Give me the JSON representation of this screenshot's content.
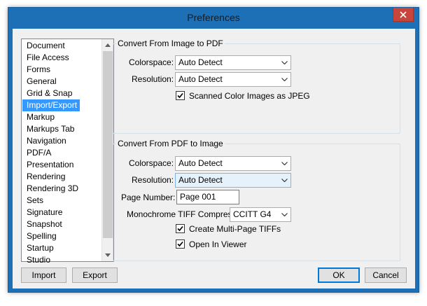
{
  "window": {
    "title": "Preferences"
  },
  "sidebar": {
    "items": [
      {
        "label": "Document"
      },
      {
        "label": "File Access"
      },
      {
        "label": "Forms"
      },
      {
        "label": "General"
      },
      {
        "label": "Grid & Snap"
      },
      {
        "label": "Import/Export",
        "selected": true
      },
      {
        "label": "Markup"
      },
      {
        "label": "Markups Tab"
      },
      {
        "label": "Navigation"
      },
      {
        "label": "PDF/A"
      },
      {
        "label": "Presentation"
      },
      {
        "label": "Rendering"
      },
      {
        "label": "Rendering 3D"
      },
      {
        "label": "Sets"
      },
      {
        "label": "Signature"
      },
      {
        "label": "Snapshot"
      },
      {
        "label": "Spelling"
      },
      {
        "label": "Startup"
      },
      {
        "label": "Studio"
      }
    ]
  },
  "image_to_pdf": {
    "title": "Convert From Image to PDF",
    "colorspace_label": "Colorspace:",
    "colorspace_value": "Auto Detect",
    "resolution_label": "Resolution:",
    "resolution_value": "Auto Detect",
    "scanned_label": "Scanned Color Images as JPEG",
    "scanned_checked": true
  },
  "pdf_to_image": {
    "title": "Convert From PDF to Image",
    "colorspace_label": "Colorspace:",
    "colorspace_value": "Auto Detect",
    "resolution_label": "Resolution:",
    "resolution_value": "Auto Detect",
    "page_number_label": "Page Number:",
    "page_number_value": "Page 001",
    "tiff_label": "Monochrome TIFF Compress:",
    "tiff_value": "CCITT G4",
    "multipage_label": "Create Multi-Page TIFFs",
    "multipage_checked": true,
    "open_viewer_label": "Open In Viewer",
    "open_viewer_checked": true
  },
  "footer": {
    "import_label": "Import",
    "export_label": "Export",
    "ok_label": "OK",
    "cancel_label": "Cancel"
  },
  "colors": {
    "title_bar": "#1e70b6",
    "close_button": "#c7453a",
    "selection": "#3399ff",
    "dialog_bg": "#f0f0f0"
  }
}
